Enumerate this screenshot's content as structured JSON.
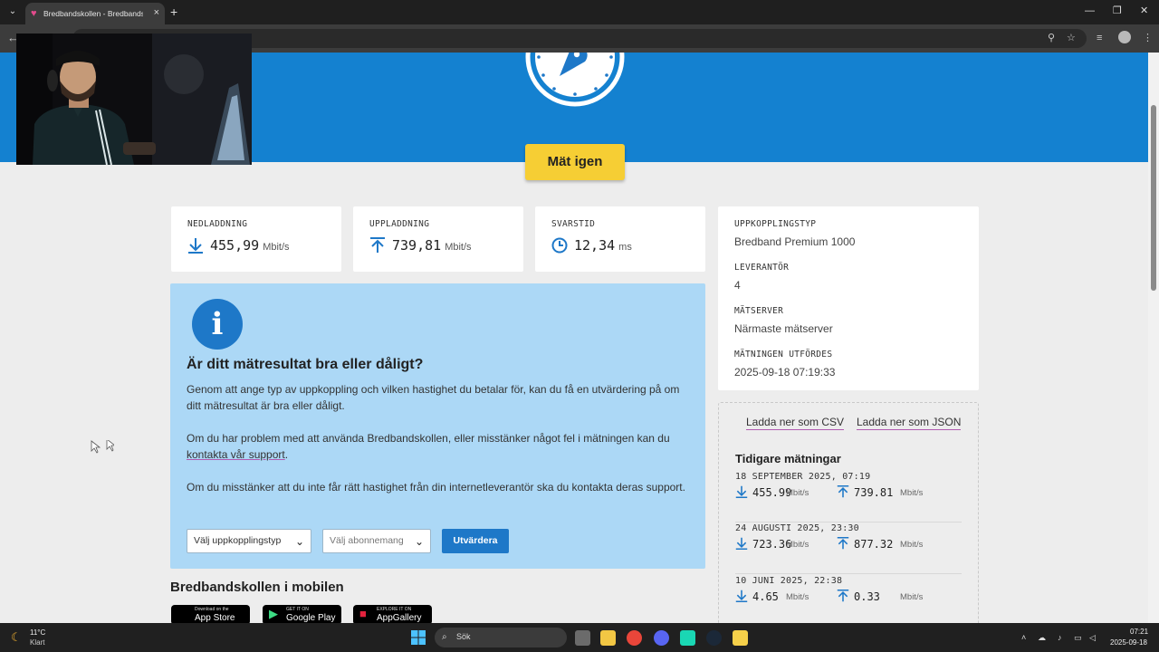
{
  "browser": {
    "tab_title": "Bredbandskollen - Bredbandskollen",
    "tab_favicon": "heart-icon",
    "new_tab_label": "+",
    "close_tab_label": "×"
  },
  "hero": {
    "remeasure_label": "Mät igen"
  },
  "stats": [
    {
      "label": "NEDLADDNING",
      "value": "455,99",
      "unit": "Mbit/s",
      "icon": "arrow-down-icon"
    },
    {
      "label": "UPPLADDNING",
      "value": "739,81",
      "unit": "Mbit/s",
      "icon": "arrow-up-icon"
    },
    {
      "label": "SVARSTID",
      "value": "12,34",
      "unit": "ms",
      "icon": "clock-icon"
    }
  ],
  "info": {
    "connection_type_label": "UPPKOPPLINGSTYP",
    "connection_type_value": "Bredband Premium 1000",
    "provider_label": "LEVERANTÖR",
    "provider_value": "4",
    "server_label": "MÄTSERVER",
    "server_value": "Närmaste mätserver",
    "performed_label": "MÄTNINGEN UTFÖRDES",
    "performed_value": "2025-09-18 07:19:33"
  },
  "evaluation": {
    "heading": "Är ditt mätresultat bra eller dåligt?",
    "p1": "Genom att ange typ av uppkoppling och vilken hastighet du betalar för, kan du få en utvärdering på om ditt mätresultat är bra eller dåligt.",
    "p2_before": "Om du har problem med att använda Bredbandskollen, eller misstänker något fel i mätningen kan du",
    "p2_link": "kontakta vår support",
    "p2_after": ".",
    "p3": "Om du misstänker att du inte får rätt hastighet från din internetleverantör ska du kontakta deras support.",
    "select_connection": "Välj uppkopplingstyp",
    "select_subscription": "Välj abonnemang",
    "evaluate_label": "Utvärdera"
  },
  "mobile": {
    "heading": "Bredbandskollen i mobilen",
    "badges": [
      {
        "small": "Download on the",
        "big": "App Store",
        "icon": "apple-icon"
      },
      {
        "small": "GET IT ON",
        "big": "Google Play",
        "icon": "play-icon"
      },
      {
        "small": "EXPLORE IT ON",
        "big": "AppGallery",
        "icon": "huawei-icon"
      }
    ]
  },
  "history": {
    "download_csv": "Ladda ner som CSV",
    "download_json": "Ladda ner som JSON",
    "heading": "Tidigare mätningar",
    "unit": "Mbit/s",
    "items": [
      {
        "date": "18 SEPTEMBER 2025, 07:19",
        "down": "455.99",
        "up": "739.81"
      },
      {
        "date": "24 AUGUSTI 2025, 23:30",
        "down": "723.36",
        "up": "877.32"
      },
      {
        "date": "10 JUNI 2025, 22:38",
        "down": "4.65",
        "up": "0.33"
      }
    ]
  },
  "taskbar": {
    "weather_temp": "11°C",
    "weather_cond": "Klart",
    "search_label": "Sök",
    "time": "07:21",
    "date": "2025-09-18"
  },
  "colors": {
    "hero_blue": "#1481d0",
    "accent_yellow": "#f6ce34",
    "icon_blue": "#1e78c8",
    "info_box": "#acd8f6",
    "link_underline": "#b05ab0"
  }
}
